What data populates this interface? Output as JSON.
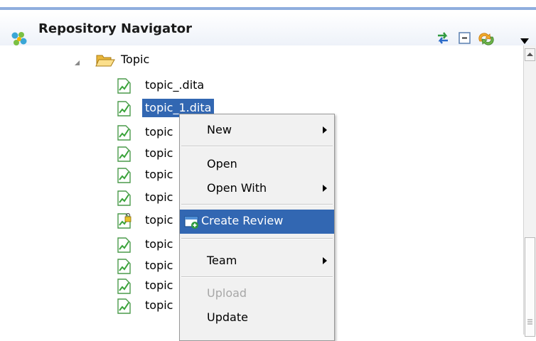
{
  "header": {
    "title": "Repository Navigator",
    "icons": [
      "sync-icon",
      "collapse-all-icon",
      "link-editor-icon",
      "view-menu-icon"
    ]
  },
  "tree": {
    "folder_label": "Topic",
    "files": [
      {
        "label": "topic_.dita",
        "locked": false
      },
      {
        "label": "topic_1.dita",
        "locked": false,
        "selected": true
      },
      {
        "label": "topic",
        "locked": false
      },
      {
        "label": "topic",
        "locked": false
      },
      {
        "label": "topic",
        "locked": false
      },
      {
        "label": "topic",
        "locked": false
      },
      {
        "label": "topic",
        "locked": true
      },
      {
        "label": "topic",
        "locked": false
      },
      {
        "label": "topic",
        "locked": false
      },
      {
        "label": "topic",
        "locked": false
      },
      {
        "label": "topic",
        "locked": false
      }
    ]
  },
  "context_menu": {
    "new": "New",
    "open": "Open",
    "open_with": "Open With",
    "create_review": "Create Review",
    "team": "Team",
    "upload": "Upload",
    "update": "Update"
  },
  "colors": {
    "selection": "#3267b2",
    "menu_bg": "#f1f1f1",
    "header_accent": "#8faede"
  }
}
